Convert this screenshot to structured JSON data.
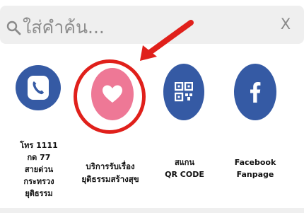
{
  "search": {
    "placeholder": "ใส่คำค้น...",
    "clear_label": "X"
  },
  "services": [
    {
      "label_lines": [
        "โทร 1111",
        "กด 77",
        "สายด่วน",
        "กระทรวง",
        "ยุติธรรม"
      ],
      "icon": "phone-icon",
      "color": "#355aa4"
    },
    {
      "label_lines": [
        "บริการรับเรื่อง",
        "ยุติธรรมสร้างสุข"
      ],
      "icon": "heart-icon",
      "color": "#ee7896"
    },
    {
      "label_lines": [
        "สแกน",
        "QR CODE"
      ],
      "icon": "qr-code-icon",
      "color": "#355aa4"
    },
    {
      "label_lines": [
        "Facebook",
        "Fanpage"
      ],
      "icon": "facebook-icon",
      "color": "#355aa4"
    }
  ],
  "colors": {
    "highlight": "#e0201b",
    "search_background": "#efefef"
  }
}
